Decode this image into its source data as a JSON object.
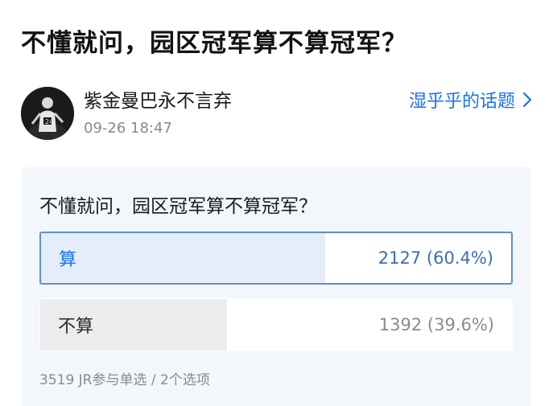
{
  "post": {
    "title": "不懂就问，园区冠军算不算冠军？"
  },
  "author": {
    "name": "紫金曼巴永不言弃",
    "time": "09-26 18:47",
    "avatar_icon": "avatar-figure-icon"
  },
  "topic": {
    "label": "湿乎乎的话题"
  },
  "poll": {
    "question": "不懂就问，园区冠军算不算冠军？",
    "options": [
      {
        "label": "算",
        "stat": "2127 (60.4%)",
        "share": 0.604,
        "selected": true
      },
      {
        "label": "不算",
        "stat": "1392 (39.6%)",
        "share": 0.396,
        "selected": false
      }
    ],
    "meta": "3519 JR参与单选 / 2个选项"
  },
  "colors": {
    "accent": "#1772f6",
    "selected_border": "#5b8fd8",
    "selected_fill": "#e5edfa",
    "unselected_fill": "#ececef",
    "card_bg": "#f3f6fb"
  }
}
